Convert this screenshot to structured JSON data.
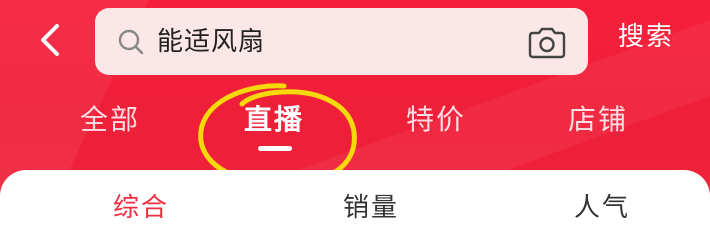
{
  "search": {
    "value": "能适风扇",
    "button_label": "搜索"
  },
  "tabs": [
    {
      "label": "全部",
      "active": false
    },
    {
      "label": "直播",
      "active": true
    },
    {
      "label": "特价",
      "active": false
    },
    {
      "label": "店铺",
      "active": false
    }
  ],
  "sort": [
    {
      "label": "综合",
      "active": true
    },
    {
      "label": "销量",
      "active": false
    },
    {
      "label": "人气",
      "active": false
    }
  ],
  "colors": {
    "header_red": "#f3223a",
    "search_bg": "#fbe7e7",
    "sort_active": "#ee2e43",
    "annotation_yellow": "#f5d90a"
  },
  "icons": {
    "back": "chevron-left-icon",
    "search": "search-icon",
    "camera": "camera-icon"
  }
}
